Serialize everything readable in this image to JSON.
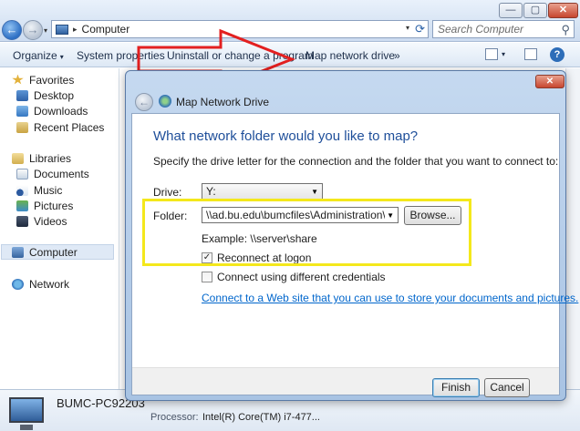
{
  "window": {
    "controls": {
      "minimize": "—",
      "maximize": "▢",
      "close": "✕"
    },
    "nav": {
      "back": "←",
      "forward": "→",
      "dropdown": "▾"
    }
  },
  "address": {
    "separator": "▸",
    "crumb": "Computer",
    "dropdown": "▾",
    "refresh": "⟳"
  },
  "search": {
    "placeholder": "Search Computer",
    "icon": "🔍"
  },
  "commandbar": {
    "organize": "Organize",
    "organize_arrow": "▾",
    "system_properties": "System properties",
    "uninstall": "Uninstall or change a program",
    "map_network_drive": "Map network drive",
    "more": "»",
    "view_arrow": "▾"
  },
  "navpane": {
    "favorites": "Favorites",
    "desktop": "Desktop",
    "downloads": "Downloads",
    "recent_places": "Recent Places",
    "libraries": "Libraries",
    "documents": "Documents",
    "music": "Music",
    "pictures": "Pictures",
    "videos": "Videos",
    "computer": "Computer",
    "network": "Network"
  },
  "details": {
    "computer_name": "BUMC-PC92203",
    "processor_label": "Processor:",
    "processor_value": "Intel(R) Core(TM) i7-477..."
  },
  "dialog": {
    "title": "Map Network Drive",
    "close": "✕",
    "back": "←",
    "heading": "What network folder would you like to map?",
    "instruction": "Specify the drive letter for the connection and the folder that you want to connect to:",
    "drive_label": "Drive:",
    "drive_value": "Y:",
    "combo_arrow": "▼",
    "folder_label": "Folder:",
    "folder_value": "\\\\ad.bu.edu\\bumcfiles\\Administration\\Office of",
    "browse": "Browse...",
    "example": "Example: \\\\server\\share",
    "reconnect_label": "Reconnect at logon",
    "reconnect_mark": "✓",
    "different_credentials_label": "Connect using different credentials",
    "link": "Connect to a Web site that you can use to store your documents and pictures.",
    "finish": "Finish",
    "cancel": "Cancel"
  },
  "colors": {
    "annotation_arrow": "#e32020",
    "highlight_box": "#f4e81b",
    "heading_blue": "#1f4f9a",
    "link_blue": "#0066cc"
  }
}
